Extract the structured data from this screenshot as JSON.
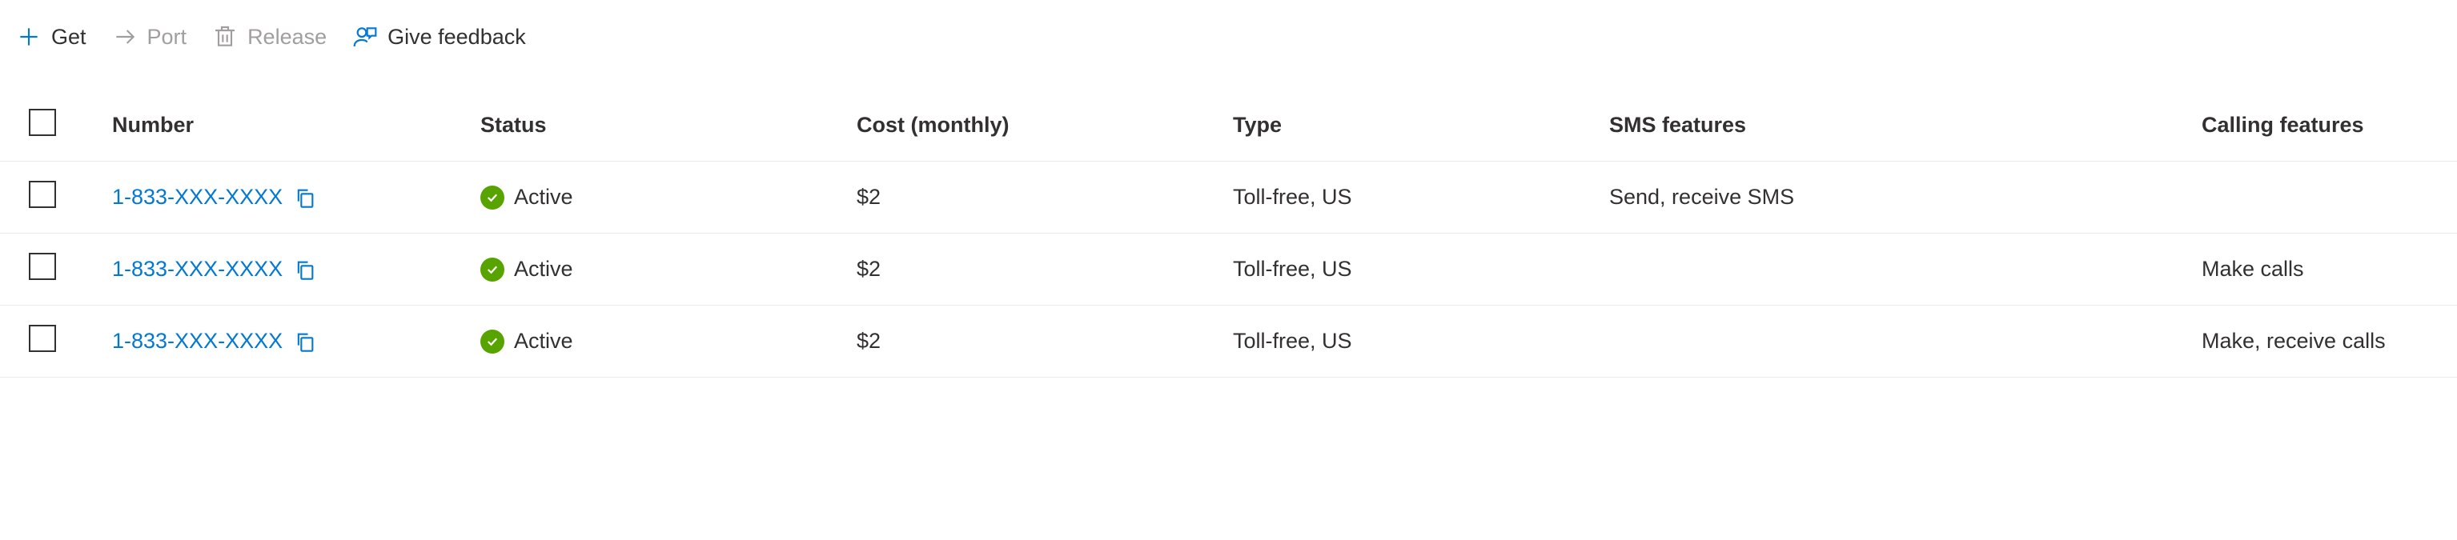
{
  "toolbar": {
    "get_label": "Get",
    "port_label": "Port",
    "release_label": "Release",
    "feedback_label": "Give feedback"
  },
  "headers": {
    "number": "Number",
    "status": "Status",
    "cost": "Cost (monthly)",
    "type": "Type",
    "sms": "SMS features",
    "calling": "Calling features"
  },
  "rows": [
    {
      "number": "1-833-XXX-XXXX",
      "status": "Active",
      "cost": "$2",
      "type": "Toll-free, US",
      "sms": "Send, receive SMS",
      "calling": ""
    },
    {
      "number": "1-833-XXX-XXXX",
      "status": "Active",
      "cost": "$2",
      "type": "Toll-free, US",
      "sms": "",
      "calling": "Make calls"
    },
    {
      "number": "1-833-XXX-XXXX",
      "status": "Active",
      "cost": "$2",
      "type": "Toll-free, US",
      "sms": "",
      "calling": "Make, receive calls"
    }
  ]
}
